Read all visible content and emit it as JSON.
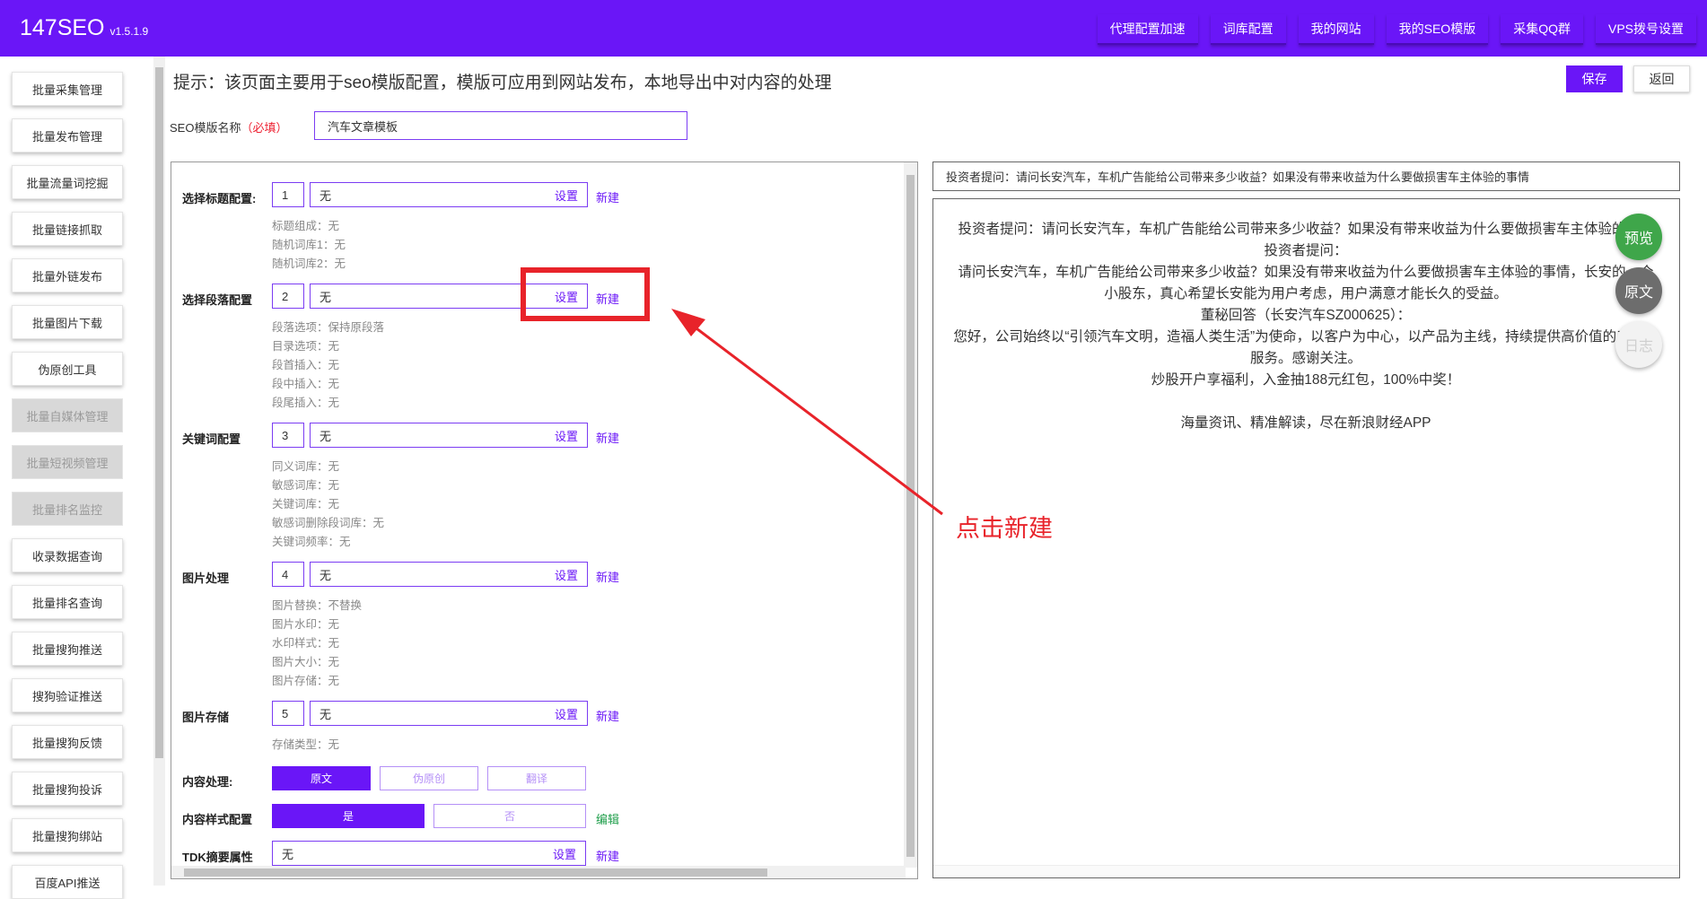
{
  "header": {
    "logo": "147SEO",
    "version": "v1.5.1.9",
    "nav": [
      "代理配置加速",
      "词库配置",
      "我的网站",
      "我的SEO模版",
      "采集QQ群",
      "VPS拨号设置"
    ]
  },
  "sidebar": {
    "items": [
      {
        "label": "批量采集管理",
        "disabled": false
      },
      {
        "label": "批量发布管理",
        "disabled": false
      },
      {
        "label": "批量流量词挖掘",
        "disabled": false
      },
      {
        "label": "批量链接抓取",
        "disabled": false
      },
      {
        "label": "批量外链发布",
        "disabled": false
      },
      {
        "label": "批量图片下载",
        "disabled": false
      },
      {
        "label": "伪原创工具",
        "disabled": false
      },
      {
        "label": "批量自媒体管理",
        "disabled": true
      },
      {
        "label": "批量短视频管理",
        "disabled": true
      },
      {
        "label": "批量排名监控",
        "disabled": true
      },
      {
        "label": "收录数据查询",
        "disabled": false
      },
      {
        "label": "批量排名查询",
        "disabled": false
      },
      {
        "label": "批量搜狗推送",
        "disabled": false
      },
      {
        "label": "搜狗验证推送",
        "disabled": false
      },
      {
        "label": "批量搜狗反馈",
        "disabled": false
      },
      {
        "label": "批量搜狗投诉",
        "disabled": false
      },
      {
        "label": "批量搜狗绑站",
        "disabled": false
      },
      {
        "label": "百度API推送",
        "disabled": false
      }
    ]
  },
  "page": {
    "hint": "提示：该页面主要用于seo模版配置，模版可应用到网站发布，本地导出中对内容的处理",
    "save_label": "保存",
    "back_label": "返回",
    "tplname_label": "SEO模版名称",
    "tplname_required": "（必填）",
    "tplname_value": "汽车文章模板"
  },
  "config": {
    "set_label": "设置",
    "new_label": "新建",
    "edit_label": "编辑",
    "title": {
      "label": "选择标题配置:",
      "num": "1",
      "value": "无",
      "details": [
        "标题组成：无",
        "随机词库1：无",
        "随机词库2：无"
      ]
    },
    "paragraph": {
      "label": "选择段落配置",
      "num": "2",
      "value": "无",
      "details": [
        "段落选项：保持原段落",
        "目录选项：无",
        "段首插入：无",
        "段中插入：无",
        "段尾插入：无"
      ]
    },
    "keyword": {
      "label": "关键词配置",
      "num": "3",
      "value": "无",
      "details": [
        "同义词库：无",
        "敏感词库：无",
        "关键词库：无",
        "敏感词删除段词库：无",
        "关键词频率：无"
      ]
    },
    "image": {
      "label": "图片处理",
      "num": "4",
      "value": "无",
      "details": [
        "图片替换：不替换",
        "图片水印：无",
        "水印样式：无",
        "图片大小：无",
        "图片存储：无"
      ]
    },
    "storage": {
      "label": "图片存储",
      "num": "5",
      "value": "无",
      "details": [
        "存储类型：无"
      ]
    },
    "content": {
      "label": "内容处理:",
      "options": [
        "原文",
        "伪原创",
        "翻译"
      ]
    },
    "style": {
      "label": "内容样式配置",
      "options": [
        "是",
        "否"
      ]
    },
    "tdk": {
      "label": "TDK摘要属性",
      "value": "无"
    }
  },
  "preview": {
    "title": "投资者提问：请问长安汽车，车机广告能给公司带来多少收益？如果没有带来收益为什么要做损害车主体验的事情",
    "lines": [
      "投资者提问：请问长安汽车，车机广告能给公司带来多少收益？如果没有带来收益为什么要做损害车主体验的事情",
      "投资者提问：",
      "请问长安汽车，车机广告能给公司带来多少收益？如果没有带来收益为什么要做损害车主体验的事情，长安的一个小股东，真心希望长安能为用户考虑，用户满意才能长久的受益。",
      "董秘回答（长安汽车SZ000625）：",
      "您好，公司始终以“引领汽车文明，造福人类生活”为使命，以客户为中心，以产品为主线，持续提供高价值的产品和服务。感谢关注。",
      "炒股开户享福利，入金抽188元红包，100%中奖！",
      "",
      "海量资讯、精准解读，尽在新浪财经APP"
    ],
    "float_preview": "预览",
    "float_origin": "原文",
    "float_log": "日志"
  },
  "annotation": {
    "text": "点击新建",
    "color": "#e8232a"
  },
  "colors": {
    "primary": "#6a16f7",
    "green": "#3fa64a",
    "edit_green": "#1e9e4a"
  }
}
